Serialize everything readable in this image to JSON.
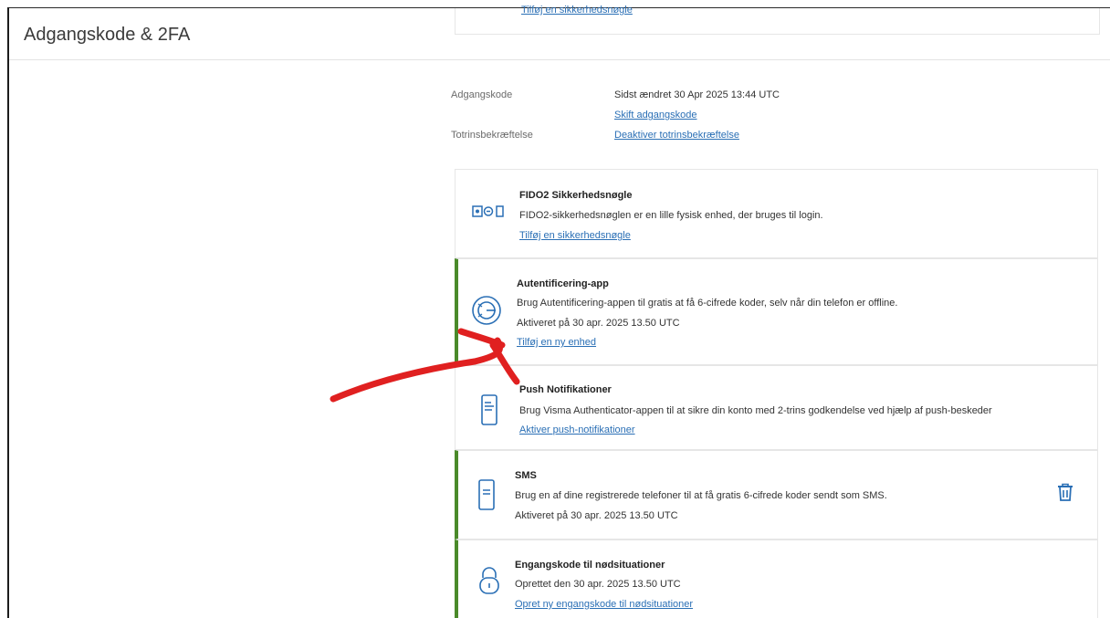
{
  "page": {
    "title": "Adgangskode & 2FA"
  },
  "top_card": {
    "link": "Tilføj en sikkerhedsnøgle"
  },
  "password": {
    "label": "Adgangskode",
    "last_changed": "Sidst ændret 30 Apr 2025 13:44 UTC",
    "change_link": "Skift adgangskode"
  },
  "two_factor": {
    "label": "Totrinsbekræftelse",
    "deactivate_link": "Deaktiver totrinsbekræftelse"
  },
  "methods": [
    {
      "title": "FIDO2 Sikkerhedsnøgle",
      "description": "FIDO2-sikkerhedsnøglen er en lille fysisk enhed, der bruges til login.",
      "link": "Tilføj en sikkerhedsnøgle",
      "icon": "security-key-icon"
    },
    {
      "title": "Autentificering-app",
      "description": "Brug Autentificering-appen til gratis at få 6-cifrede koder, selv når din telefon er offline.",
      "status": "Aktiveret på 30 apr. 2025 13.50 UTC",
      "link": "Tilføj en ny enhed",
      "icon": "authenticator-app-icon"
    },
    {
      "title": "Push Notifikationer",
      "description": "Brug Visma Authenticator-appen til at sikre din konto med 2-trins godkendelse ved hjælp af push-beskeder",
      "link": "Aktiver push-notifikationer",
      "icon": "phone-icon"
    },
    {
      "title": "SMS",
      "description": "Brug en af dine registrerede telefoner til at få gratis 6-cifrede koder sendt som SMS.",
      "status": "Aktiveret på 30 apr. 2025 13.50 UTC",
      "icon": "sms-phone-icon"
    },
    {
      "title": "Engangskode til nødsituationer",
      "status": "Oprettet den 30 apr. 2025 13.50 UTC",
      "link": "Opret ny engangskode til nødsituationer",
      "icon": "lock-icon"
    }
  ],
  "colors": {
    "link": "#2a6fb5",
    "active_bar": "#4a8a2a",
    "annotation": "#e02020"
  }
}
